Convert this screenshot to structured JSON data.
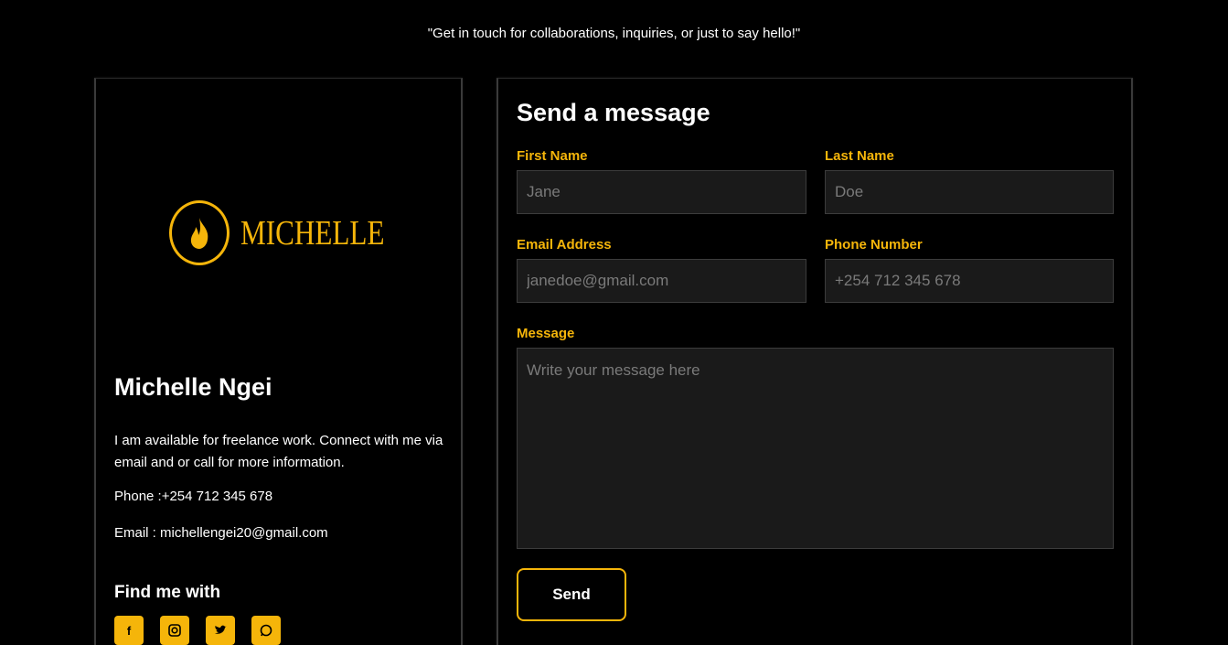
{
  "tagline": "\"Get in touch for collaborations, inquiries, or just to say hello!\"",
  "profile": {
    "logo_text": "MICHELLE",
    "name": "Michelle Ngei",
    "bio": "I am available for freelance work. Connect with me via email and or call for more information.",
    "phone": "Phone :+254 712 345 678",
    "email": "Email : michellengei20@gmail.com",
    "find_me": "Find me with",
    "socials": [
      "facebook-icon",
      "instagram-icon",
      "twitter-icon",
      "whatsapp-icon"
    ]
  },
  "form": {
    "title": "Send a message",
    "first_name": {
      "label": "First Name",
      "placeholder": "Jane"
    },
    "last_name": {
      "label": "Last Name",
      "placeholder": "Doe"
    },
    "email": {
      "label": "Email Address",
      "placeholder": "janedoe@gmail.com"
    },
    "phone": {
      "label": "Phone Number",
      "placeholder": "+254 712 345 678"
    },
    "message": {
      "label": "Message",
      "placeholder": "Write your message here"
    },
    "submit": "Send"
  },
  "colors": {
    "accent": "#f5b50a",
    "background": "#000000",
    "field": "#1a1a1a"
  }
}
